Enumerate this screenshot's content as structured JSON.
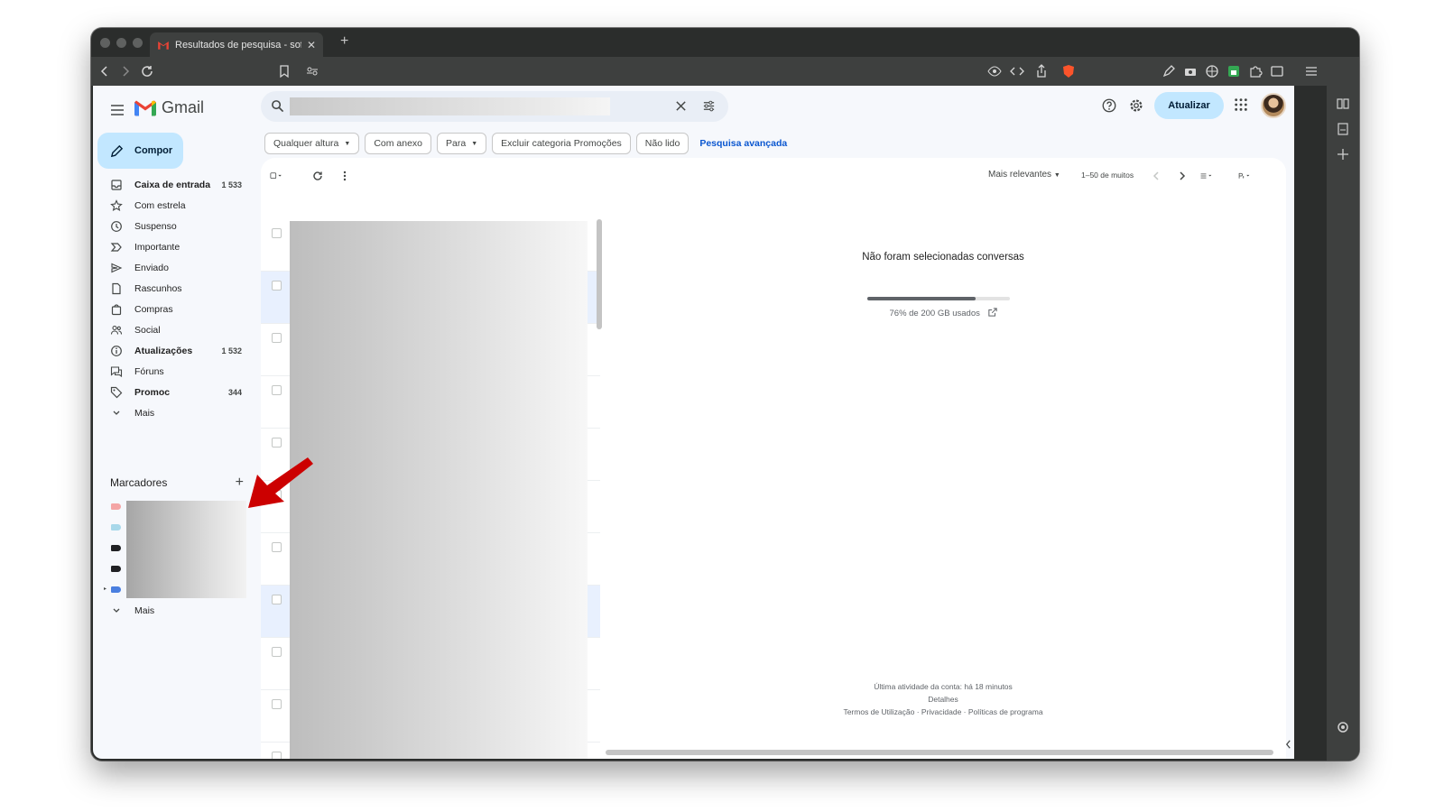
{
  "browser": {
    "tab_title": "Resultados de pesquisa - sofi",
    "tab_close": "✕",
    "new_tab": "+"
  },
  "gmail": {
    "logo_text": "Gmail",
    "update_button": "Atualizar",
    "compose": "Compor",
    "nav": [
      {
        "label": "Caixa de entrada",
        "count": "1 533",
        "bold": true,
        "icon": "inbox-icon"
      },
      {
        "label": "Com estrela",
        "count": "",
        "bold": false,
        "icon": "star-icon"
      },
      {
        "label": "Suspenso",
        "count": "",
        "bold": false,
        "icon": "clock-icon"
      },
      {
        "label": "Importante",
        "count": "",
        "bold": false,
        "icon": "important-icon"
      },
      {
        "label": "Enviado",
        "count": "",
        "bold": false,
        "icon": "send-icon"
      },
      {
        "label": "Rascunhos",
        "count": "",
        "bold": false,
        "icon": "draft-icon"
      },
      {
        "label": "Compras",
        "count": "",
        "bold": false,
        "icon": "shopping-icon"
      },
      {
        "label": "Social",
        "count": "",
        "bold": false,
        "icon": "people-icon"
      },
      {
        "label": "Atualizações",
        "count": "1 532",
        "bold": true,
        "icon": "info-icon"
      },
      {
        "label": "Fóruns",
        "count": "",
        "bold": false,
        "icon": "forum-icon"
      },
      {
        "label": "Promoc",
        "count": "344",
        "bold": true,
        "icon": "tag-icon"
      },
      {
        "label": "Mais",
        "count": "",
        "bold": false,
        "icon": "chevron-down-icon"
      }
    ],
    "labels_title": "Marcadores",
    "labels_add": "+",
    "label_colors": [
      "#f4a5a5",
      "#a8d8ea",
      "#202124",
      "#202124",
      "#4a7fe0"
    ],
    "labels_more": "Mais",
    "filters": [
      {
        "label": "Qualquer altura",
        "dropdown": true
      },
      {
        "label": "Com anexo",
        "dropdown": false
      },
      {
        "label": "Para",
        "dropdown": true
      },
      {
        "label": "Excluir categoria Promoções",
        "dropdown": false
      },
      {
        "label": "Não lido",
        "dropdown": false
      }
    ],
    "advanced_search": "Pesquisa avançada",
    "sort": "Mais relevantes",
    "pagination": "1–50 de muitos",
    "empty_message": "Não foram selecionadas conversas",
    "storage_text": "76% de 200 GB usados",
    "storage_used_fraction": 0.76,
    "footer": {
      "activity": "Última atividade da conta: há 18 minutos",
      "details": "Detalhes",
      "links": "Termos de Utilização · Privacidade · Políticas de programa"
    },
    "accent": "#c2e7ff",
    "arrow_color": "#cc0000"
  }
}
